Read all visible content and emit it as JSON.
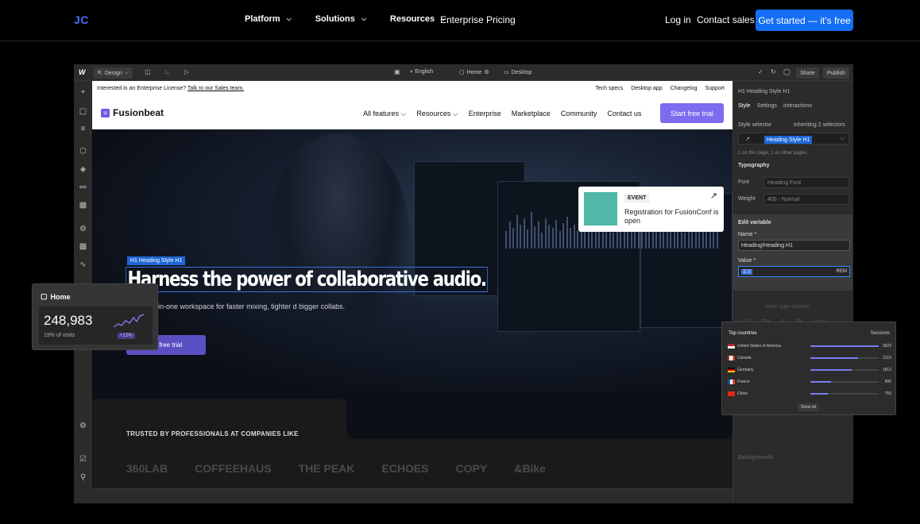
{
  "topnav": {
    "logo": "JC",
    "items": [
      "Platform",
      "Solutions",
      "Resources"
    ],
    "enterprise": "Enterprise",
    "pricing": "Pricing",
    "login": "Log in",
    "contact": "Contact sales",
    "cta": "Get started — it's free"
  },
  "editor": {
    "topbar": {
      "mode": "Design",
      "language": "English",
      "page": "Home",
      "breakpoint": "Desktop",
      "share": "Share",
      "publish": "Publish"
    },
    "site": {
      "announce_text": "Interested in an Enterprise License?",
      "announce_link": "Talk to our Sales team.",
      "announce_links": [
        "Tech specs",
        "Desktop app",
        "Changelog",
        "Support"
      ],
      "brand": "Fusionbeat",
      "nav": [
        "All features",
        "Resources",
        "Enterprise",
        "Marketplace",
        "Community",
        "Contact us"
      ],
      "trial": "Start free trial",
      "event_tag": "EVENT",
      "event_text": "Registration for FusionConf is open",
      "h1_tag": "H1  Heading Style H1",
      "h1": "Harness the power of collaborative audio.",
      "sub": "ce the all-in-one workspace for faster mixing, tighter d bigger collabs.",
      "hero_btn": "art free trial",
      "trusted": "TRUSTED BY PROFESSIONALS AT COMPANIES LIKE",
      "logos": [
        "360LAB",
        "COFFEEHAUS",
        "THE PEAK",
        "ECHOES",
        "COPY",
        "&Bike"
      ]
    },
    "panel": {
      "title": "Heading Style H1",
      "tabs": [
        "Style",
        "Settings",
        "Interactions"
      ],
      "style_selector": "Style selector",
      "inheriting": "Inheriting 2 selectors",
      "selector_chip": "Heading Style H1",
      "on_page": "1 on this page, 1 on other pages.",
      "typography": "Typography",
      "font_label": "Font",
      "font_value": "Heading Font",
      "weight_label": "Weight",
      "weight_value": "400 - Normal",
      "edit_variable": "Edit variable",
      "name_label": "Name *",
      "name_value": "Heading/Heading H1",
      "value_label": "Value *",
      "value_value": "3.5",
      "value_unit": "REM",
      "more_type": "More type options",
      "spacing_values": [
        "-0.01",
        "EM",
        "0",
        "PX",
        "Auto"
      ],
      "backgrounds": "Backgrounds"
    }
  },
  "home_card": {
    "title": "Home",
    "value": "248,983",
    "percent": "19% of visits",
    "change": "+12%"
  },
  "countries": {
    "title": "Top countries",
    "metric": "Sessions",
    "rows": [
      {
        "name": "United States of America",
        "value": "3022",
        "fraction": 1.0
      },
      {
        "name": "Canada",
        "value": "2115",
        "fraction": 0.7
      },
      {
        "name": "Germany",
        "value": "1813",
        "fraction": 0.6
      },
      {
        "name": "France",
        "value": "906",
        "fraction": 0.3
      },
      {
        "name": "China",
        "value": "755",
        "fraction": 0.25
      }
    ],
    "show_all": "Show all"
  }
}
